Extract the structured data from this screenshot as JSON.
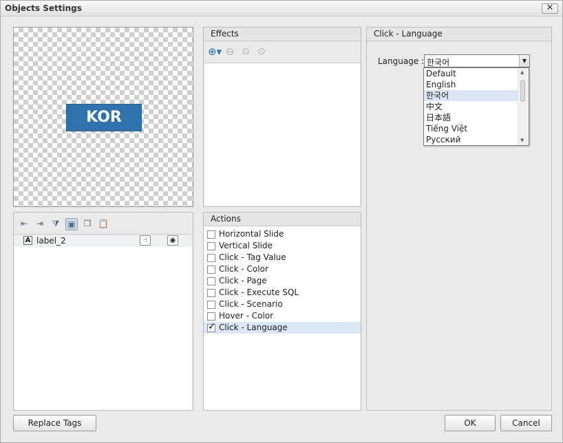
{
  "window": {
    "title": "Objects Settings",
    "close_glyph": "✕"
  },
  "preview": {
    "label": "KOR",
    "label_color": "#2f72ac"
  },
  "layers": {
    "toolbar_icons": [
      "indent-left-icon",
      "indent-right-icon",
      "filter-icon",
      "image-icon",
      "copy-icon",
      "paste-icon"
    ],
    "items": [
      {
        "name": "label_2",
        "type_icon": "A"
      }
    ]
  },
  "effects": {
    "header": "Effects",
    "toolbar_icons": [
      "add-icon",
      "remove-icon",
      "move-up-icon",
      "move-down-icon"
    ]
  },
  "actions": {
    "header": "Actions",
    "items": [
      {
        "label": "Horizontal Slide",
        "checked": false
      },
      {
        "label": "Vertical Slide",
        "checked": false
      },
      {
        "label": "Click - Tag Value",
        "checked": false
      },
      {
        "label": "Click - Color",
        "checked": false
      },
      {
        "label": "Click - Page",
        "checked": false
      },
      {
        "label": "Click - Execute SQL",
        "checked": false
      },
      {
        "label": "Click - Scenario",
        "checked": false
      },
      {
        "label": "Hover - Color",
        "checked": false
      },
      {
        "label": "Click - Language",
        "checked": true
      }
    ]
  },
  "detail": {
    "header": "Click - Language",
    "language_label": "Language :",
    "language_value": "한국어",
    "options": [
      "Default",
      "English",
      "한국어",
      "中文",
      "日本語",
      "Tiếng Việt",
      "Русский"
    ],
    "selected_index": 2
  },
  "footer": {
    "replace_tags": "Replace Tags",
    "ok": "OK",
    "cancel": "Cancel"
  },
  "colors": {
    "accent": "#2f72ac",
    "selection": "#dbe7f5"
  }
}
